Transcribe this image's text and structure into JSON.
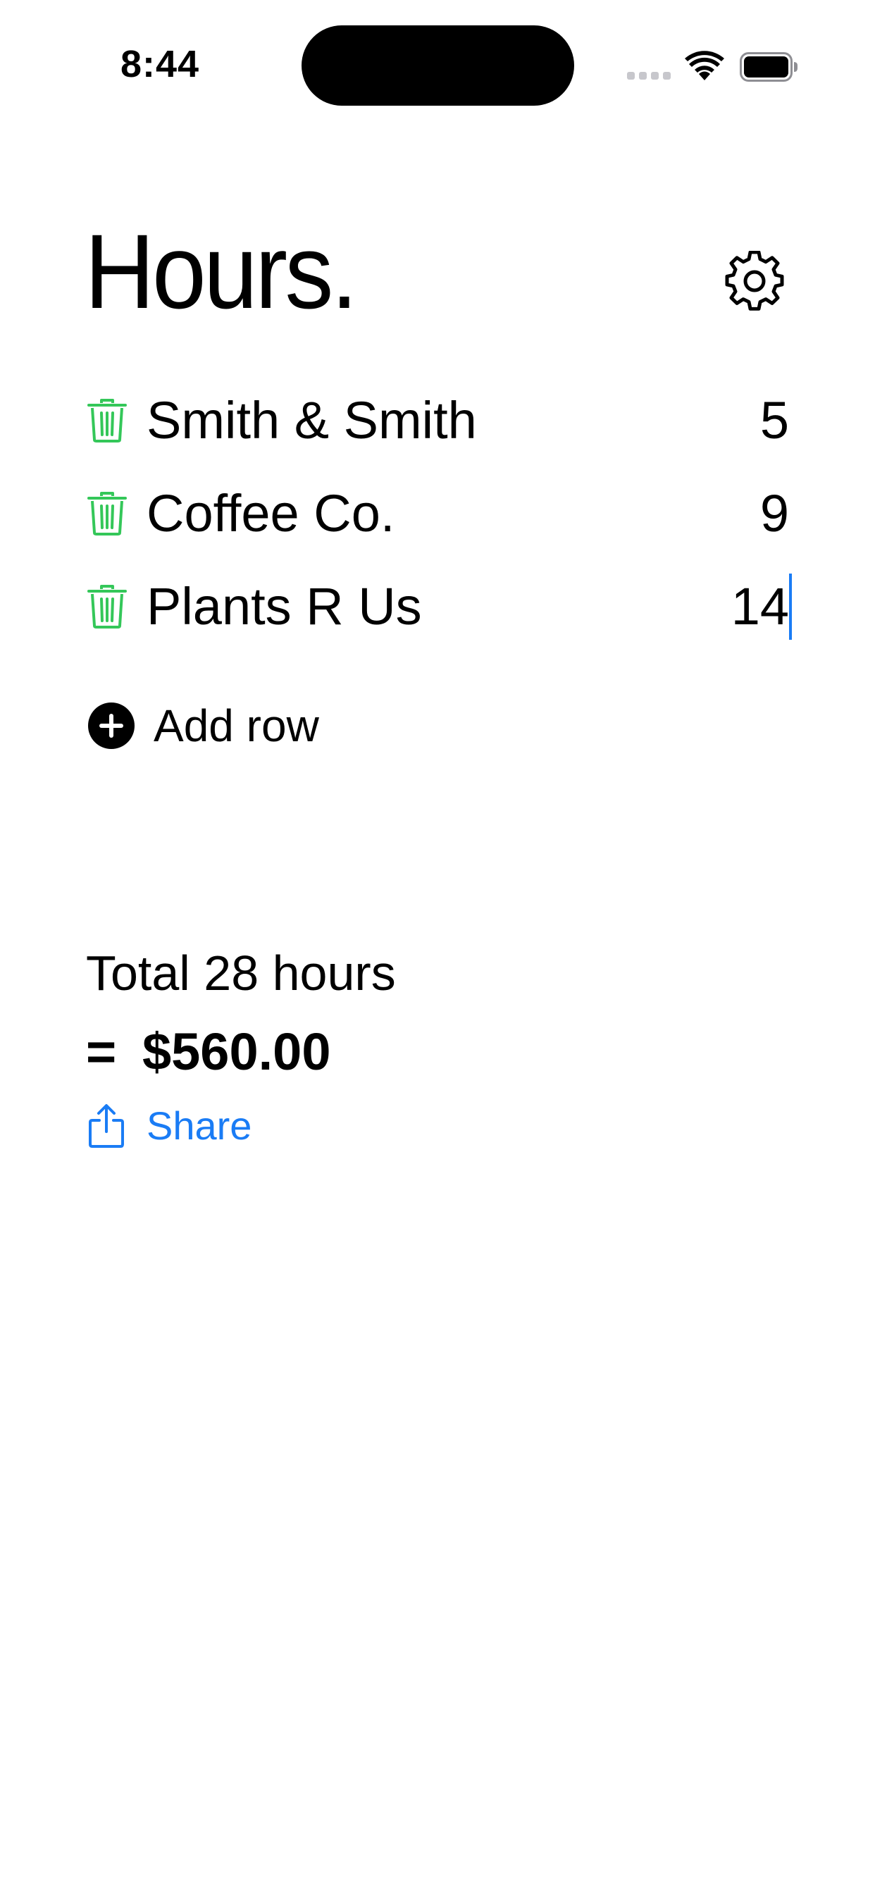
{
  "status_bar": {
    "time": "8:44",
    "icons": [
      "cellular-signal-icon",
      "wifi-icon",
      "battery-icon"
    ]
  },
  "header": {
    "title": "Hours.",
    "settings_icon": "gear-icon"
  },
  "rows": [
    {
      "name": "Smith & Smith",
      "hours": "5",
      "delete_icon": "trash-icon"
    },
    {
      "name": "Coffee Co.",
      "hours": "9",
      "delete_icon": "trash-icon"
    },
    {
      "name": "Plants R Us",
      "hours": "14",
      "delete_icon": "trash-icon",
      "editing": true
    }
  ],
  "add_row": {
    "label": "Add row",
    "icon": "plus-circle-icon"
  },
  "totals": {
    "hours_text": "Total 28 hours",
    "equals": "=",
    "amount": "$560.00"
  },
  "share": {
    "label": "Share",
    "icon": "share-icon"
  },
  "colors": {
    "accent": "#1a7cf5",
    "delete": "#34c759",
    "text": "#000000",
    "background": "#ffffff"
  }
}
